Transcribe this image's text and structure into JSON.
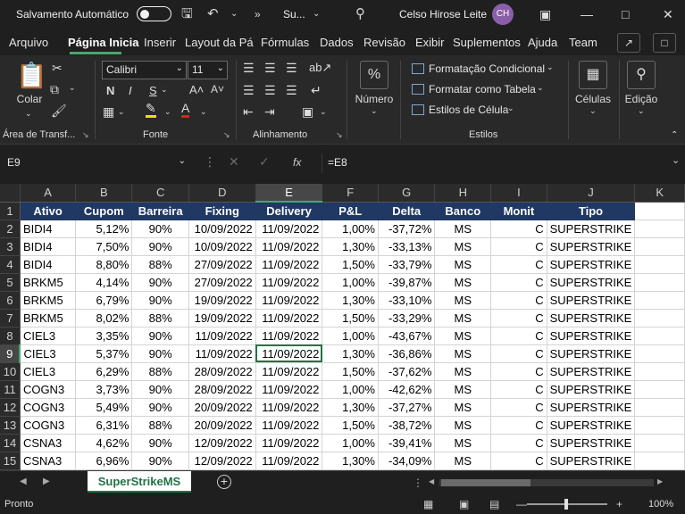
{
  "titlebar": {
    "autosave_label": "Salvamento Automático",
    "autosave_state": "off",
    "doc_name": "Su...",
    "user_name": "Celso Hirose Leite",
    "user_initials": "CH"
  },
  "ribbon_tabs": [
    "Arquivo",
    "Página Inicial",
    "Inserir",
    "Layout da Página",
    "Fórmulas",
    "Dados",
    "Revisão",
    "Exibir",
    "Suplementos",
    "Ajuda",
    "Team"
  ],
  "ribbon_tabs_display": [
    "Arquivo",
    "Página Inicia",
    "Inserir",
    "Layout da Pá",
    "Fórmulas",
    "Dados",
    "Revisão",
    "Exibir",
    "Suplementos",
    "Ajuda",
    "Team"
  ],
  "active_tab": "Página Inicial",
  "ribbon": {
    "clipboard": {
      "paste_label": "Colar",
      "group_label": "Área de Transf..."
    },
    "font": {
      "family": "Calibri",
      "size": "11",
      "bold": "N",
      "italic": "I",
      "underline": "S",
      "group_label": "Fonte"
    },
    "alignment": {
      "group_label": "Alinhamento"
    },
    "number": {
      "label": "Número",
      "symbol": "%"
    },
    "styles": {
      "conditional": "Formatação Condicional",
      "format_table": "Formatar como Tabela",
      "cell_styles": "Estilos de Célula",
      "group_label": "Estilos"
    },
    "cells_label": "Células",
    "editing_label": "Edição"
  },
  "formula_bar": {
    "name_box": "E9",
    "formula": "=E8"
  },
  "columns": [
    "A",
    "B",
    "C",
    "D",
    "E",
    "F",
    "G",
    "H",
    "I",
    "J",
    "K"
  ],
  "selected_column": "E",
  "selected_row": 9,
  "table_headers": [
    "Ativo",
    "Cupom",
    "Barreira",
    "Fixing",
    "Delivery",
    "P&L",
    "Delta",
    "Banco",
    "Monit",
    "Tipo"
  ],
  "rows": [
    [
      "BIDI4",
      "5,12%",
      "90%",
      "10/09/2022",
      "11/09/2022",
      "1,00%",
      "-37,72%",
      "MS",
      "C",
      "SUPERSTRIKE"
    ],
    [
      "BIDI4",
      "7,50%",
      "90%",
      "10/09/2022",
      "11/09/2022",
      "1,30%",
      "-33,13%",
      "MS",
      "C",
      "SUPERSTRIKE"
    ],
    [
      "BIDI4",
      "8,80%",
      "88%",
      "27/09/2022",
      "11/09/2022",
      "1,50%",
      "-33,79%",
      "MS",
      "C",
      "SUPERSTRIKE"
    ],
    [
      "BRKM5",
      "4,14%",
      "90%",
      "27/09/2022",
      "11/09/2022",
      "1,00%",
      "-39,87%",
      "MS",
      "C",
      "SUPERSTRIKE"
    ],
    [
      "BRKM5",
      "6,79%",
      "90%",
      "19/09/2022",
      "11/09/2022",
      "1,30%",
      "-33,10%",
      "MS",
      "C",
      "SUPERSTRIKE"
    ],
    [
      "BRKM5",
      "8,02%",
      "88%",
      "19/09/2022",
      "11/09/2022",
      "1,50%",
      "-33,29%",
      "MS",
      "C",
      "SUPERSTRIKE"
    ],
    [
      "CIEL3",
      "3,35%",
      "90%",
      "11/09/2022",
      "11/09/2022",
      "1,00%",
      "-43,67%",
      "MS",
      "C",
      "SUPERSTRIKE"
    ],
    [
      "CIEL3",
      "5,37%",
      "90%",
      "11/09/2022",
      "11/09/2022",
      "1,30%",
      "-36,86%",
      "MS",
      "C",
      "SUPERSTRIKE"
    ],
    [
      "CIEL3",
      "6,29%",
      "88%",
      "28/09/2022",
      "11/09/2022",
      "1,50%",
      "-37,62%",
      "MS",
      "C",
      "SUPERSTRIKE"
    ],
    [
      "COGN3",
      "3,73%",
      "90%",
      "28/09/2022",
      "11/09/2022",
      "1,00%",
      "-42,62%",
      "MS",
      "C",
      "SUPERSTRIKE"
    ],
    [
      "COGN3",
      "5,49%",
      "90%",
      "20/09/2022",
      "11/09/2022",
      "1,30%",
      "-37,27%",
      "MS",
      "C",
      "SUPERSTRIKE"
    ],
    [
      "COGN3",
      "6,31%",
      "88%",
      "20/09/2022",
      "11/09/2022",
      "1,50%",
      "-38,72%",
      "MS",
      "C",
      "SUPERSTRIKE"
    ],
    [
      "CSNA3",
      "4,62%",
      "90%",
      "12/09/2022",
      "11/09/2022",
      "1,00%",
      "-39,41%",
      "MS",
      "C",
      "SUPERSTRIKE"
    ],
    [
      "CSNA3",
      "6,96%",
      "90%",
      "12/09/2022",
      "11/09/2022",
      "1,30%",
      "-34,09%",
      "MS",
      "C",
      "SUPERSTRIKE"
    ]
  ],
  "sheet_tabs": [
    "SuperStrikeMS"
  ],
  "status": {
    "mode": "Pronto",
    "zoom": "100%"
  }
}
